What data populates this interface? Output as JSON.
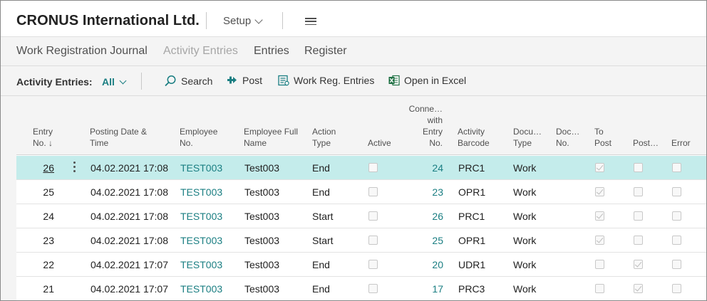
{
  "app": {
    "company": "CRONUS International Ltd.",
    "setup_label": "Setup"
  },
  "nav": {
    "items": [
      {
        "label": "Work Registration Journal",
        "muted": false
      },
      {
        "label": "Activity Entries",
        "muted": true
      },
      {
        "label": "Entries",
        "muted": false
      },
      {
        "label": "Register",
        "muted": false
      }
    ]
  },
  "actionbar": {
    "label": "Activity Entries:",
    "filter": "All",
    "search": "Search",
    "post": "Post",
    "work_reg_entries": "Work Reg. Entries",
    "open_in_excel": "Open in Excel"
  },
  "columns": {
    "entry_no": [
      "Entry",
      "No. ↓"
    ],
    "posting_date": [
      "Posting Date &",
      "Time"
    ],
    "employee_no": [
      "Employee",
      "No."
    ],
    "employee_full_name": [
      "Employee Full",
      "Name"
    ],
    "action_type": [
      "Action",
      "Type"
    ],
    "active": [
      "Active"
    ],
    "connected_entry": [
      "Conne…",
      "with",
      "Entry",
      "No."
    ],
    "activity_barcode": [
      "Activity",
      "Barcode"
    ],
    "document_type": [
      "Docu…",
      "Type"
    ],
    "document_no": [
      "Doc…",
      "No."
    ],
    "to_post": [
      "To",
      "Post"
    ],
    "posted": [
      "Post…"
    ],
    "error": [
      "Error"
    ]
  },
  "rows": [
    {
      "entry_no": "26",
      "posting_date": "04.02.2021 17:08",
      "employee_no": "TEST003",
      "employee_name": "Test003",
      "action_type": "End",
      "active": false,
      "connected_entry": "24",
      "barcode": "PRC1",
      "doc_type": "Work",
      "doc_no": "",
      "to_post": true,
      "posted": false,
      "error": false,
      "selected": true
    },
    {
      "entry_no": "25",
      "posting_date": "04.02.2021 17:08",
      "employee_no": "TEST003",
      "employee_name": "Test003",
      "action_type": "End",
      "active": false,
      "connected_entry": "23",
      "barcode": "OPR1",
      "doc_type": "Work",
      "doc_no": "",
      "to_post": true,
      "posted": false,
      "error": false,
      "selected": false
    },
    {
      "entry_no": "24",
      "posting_date": "04.02.2021 17:08",
      "employee_no": "TEST003",
      "employee_name": "Test003",
      "action_type": "Start",
      "active": false,
      "connected_entry": "26",
      "barcode": "PRC1",
      "doc_type": "Work",
      "doc_no": "",
      "to_post": true,
      "posted": false,
      "error": false,
      "selected": false
    },
    {
      "entry_no": "23",
      "posting_date": "04.02.2021 17:08",
      "employee_no": "TEST003",
      "employee_name": "Test003",
      "action_type": "Start",
      "active": false,
      "connected_entry": "25",
      "barcode": "OPR1",
      "doc_type": "Work",
      "doc_no": "",
      "to_post": true,
      "posted": false,
      "error": false,
      "selected": false
    },
    {
      "entry_no": "22",
      "posting_date": "04.02.2021 17:07",
      "employee_no": "TEST003",
      "employee_name": "Test003",
      "action_type": "End",
      "active": false,
      "connected_entry": "20",
      "barcode": "UDR1",
      "doc_type": "Work",
      "doc_no": "",
      "to_post": false,
      "posted": true,
      "error": false,
      "selected": false
    },
    {
      "entry_no": "21",
      "posting_date": "04.02.2021 17:07",
      "employee_no": "TEST003",
      "employee_name": "Test003",
      "action_type": "End",
      "active": false,
      "connected_entry": "17",
      "barcode": "PRC3",
      "doc_type": "Work",
      "doc_no": "",
      "to_post": false,
      "posted": true,
      "error": false,
      "selected": false
    }
  ],
  "colors": {
    "accent": "#1a7e82",
    "selected_row": "#c4eceb"
  }
}
